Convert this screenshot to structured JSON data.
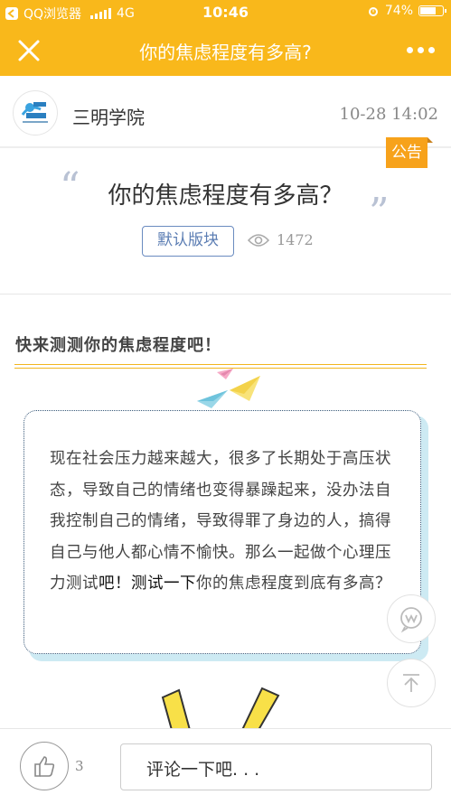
{
  "status": {
    "carrier": "QQ浏览器",
    "network": "4G",
    "time": "10:46",
    "battery": "74%",
    "battery_level": 0.74
  },
  "nav": {
    "title": "你的焦虑程度有多高?",
    "close_icon": "close-icon",
    "more_icon": "more-icon"
  },
  "author": {
    "name": "三明学院",
    "time": "10-28 14:02",
    "avatar_icon": "school-logo"
  },
  "post": {
    "badge": "公告",
    "title": "你的焦虑程度有多高？",
    "tag": "默认版块",
    "views": "1472"
  },
  "section": {
    "heading": "快来测测你的焦虑程度吧！",
    "paragraph_a": "现在社会压力越来越大，很多了长期处于高压状态，导致自己的情绪也变得暴躁起来，没办法自我控制自己的情绪，导致得罪了身边的人，搞得自己与他人都心情不愉快。那么一起做个心理压力测试",
    "paragraph_b": "吧！测试一下",
    "paragraph_c": "你的焦虑程度到底有多高？"
  },
  "bottom": {
    "like_count": "3",
    "comment_placeholder": "评论一下吧. . ."
  },
  "colors": {
    "brand": "#F9B81B",
    "badge": "#F7A21B",
    "tag_border": "#6a8bc0"
  }
}
